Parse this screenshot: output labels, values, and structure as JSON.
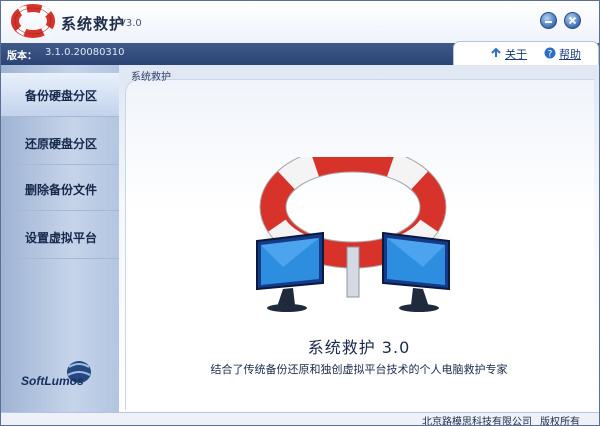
{
  "window": {
    "title": "系统救护",
    "version_suffix": "V3.0",
    "minimize_icon": "minimize-icon",
    "close_icon": "close-icon"
  },
  "topbar": {
    "version_label": "版本：",
    "version_value": "3.1.0.20080310",
    "links": [
      {
        "label": "关于",
        "icon": "info-arrow-icon"
      },
      {
        "label": "帮助",
        "icon": "help-icon"
      }
    ]
  },
  "sidebar": {
    "items": [
      {
        "label": "备份硬盘分区",
        "active": true
      },
      {
        "label": "还原硬盘分区",
        "active": false
      },
      {
        "label": "删除备份文件",
        "active": false
      },
      {
        "label": "设置虚拟平台",
        "active": false
      }
    ],
    "brand": "SoftLumos"
  },
  "main": {
    "breadcrumb": "系统救护",
    "product_name": "系统救护 3.0",
    "description": "结合了传统备份还原和独创虚拟平台技术的个人电脑救护专家"
  },
  "status": {
    "company": "北京路模思科技有限公司",
    "rights": "版权所有"
  },
  "colors": {
    "accent": "#2b4473",
    "lifebuoy_red": "#d8332b",
    "sidebar": "#b3c5e1"
  }
}
